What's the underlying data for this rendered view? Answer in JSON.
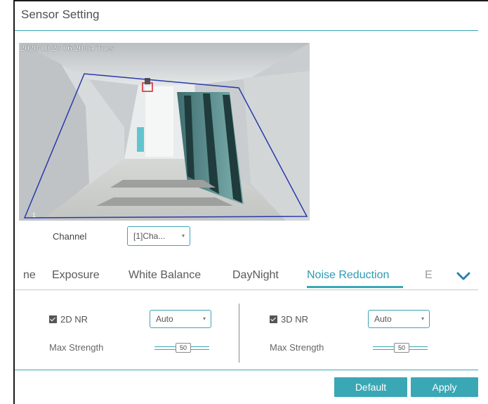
{
  "page": {
    "title": "Sensor Setting"
  },
  "preview": {
    "osd_timestamp": "2020-10-27 06:20:54 Tues",
    "channel_number": "1"
  },
  "channel": {
    "label": "Channel",
    "value": "[1]Cha...",
    "arrow": "▾"
  },
  "tabs": {
    "items": [
      {
        "label": "ne"
      },
      {
        "label": "Exposure"
      },
      {
        "label": "White Balance"
      },
      {
        "label": "DayNight"
      },
      {
        "label": "Noise Reduction",
        "active": true
      },
      {
        "label": "E"
      }
    ],
    "more_icon": "chevron-down-icon"
  },
  "nr2d": {
    "label": "2D NR",
    "checked": true,
    "mode": "Auto",
    "strength_label": "Max Strength",
    "strength_value": "50"
  },
  "nr3d": {
    "label": "3D NR",
    "checked": true,
    "mode": "Auto",
    "strength_label": "Max Strength",
    "strength_value": "50"
  },
  "buttons": {
    "default": "Default",
    "apply": "Apply"
  },
  "colors": {
    "accent": "#3aa7b5",
    "roi_line": "#2a3aa8"
  }
}
